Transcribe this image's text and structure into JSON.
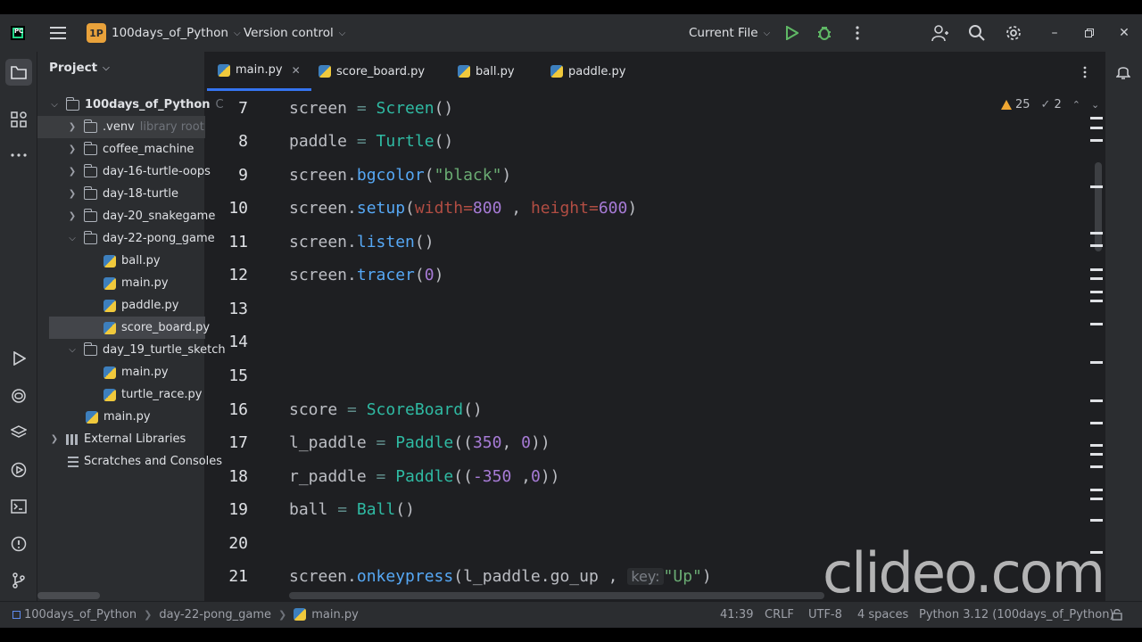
{
  "titlebar": {
    "project_badge": "1P",
    "project_name": "100days_of_Python",
    "vcs_label": "Version control",
    "run_config": "Current File"
  },
  "tabs": [
    {
      "label": "main.py",
      "active": true
    },
    {
      "label": "score_board.py"
    },
    {
      "label": "ball.py"
    },
    {
      "label": "paddle.py"
    }
  ],
  "project_panel": {
    "title": "Project",
    "tree": [
      {
        "label": "100days_of_Python",
        "type": "folder",
        "expanded": true,
        "suffix": "C"
      },
      {
        "label": ".venv",
        "type": "folder",
        "suffix": "library root"
      },
      {
        "label": "coffee_machine",
        "type": "folder"
      },
      {
        "label": "day-16-turtle-oops",
        "type": "folder"
      },
      {
        "label": "day-18-turtle",
        "type": "folder"
      },
      {
        "label": "day-20_snakegame",
        "type": "folder"
      },
      {
        "label": "day-22-pong_game",
        "type": "folder",
        "expanded": true
      },
      {
        "label": "ball.py",
        "type": "py"
      },
      {
        "label": "main.py",
        "type": "py"
      },
      {
        "label": "paddle.py",
        "type": "py"
      },
      {
        "label": "score_board.py",
        "type": "py",
        "selected": true
      },
      {
        "label": "day_19_turtle_sketch",
        "type": "folder",
        "expanded": true
      },
      {
        "label": "main.py",
        "type": "py"
      },
      {
        "label": "turtle_race.py",
        "type": "py"
      },
      {
        "label": "main.py",
        "type": "py"
      },
      {
        "label": "External Libraries",
        "type": "lib"
      },
      {
        "label": "Scratches and Consoles",
        "type": "scratch"
      }
    ]
  },
  "editor": {
    "line_numbers": [
      "7",
      "8",
      "9",
      "10",
      "11",
      "12",
      "13",
      "14",
      "15",
      "16",
      "17",
      "18",
      "19",
      "20",
      "21"
    ],
    "inspections": {
      "warnings": "25",
      "weak_warnings": "2"
    },
    "code": {
      "l7_var": "screen",
      "l7_op": " = ",
      "l7_cls": "Screen",
      "l7_rest": "()",
      "l8_var": "paddle",
      "l8_op": " = ",
      "l8_cls": "Turtle",
      "l8_rest": "()",
      "l9_var": "screen.",
      "l9_call": "bgcolor",
      "l9_p1": "(",
      "l9_str": "\"black\"",
      "l9_p2": ")",
      "l10_var": "screen.",
      "l10_call": "setup",
      "l10_p1": "(",
      "l10_param1": "width=",
      "l10_num1": "800",
      "l10_sep": " , ",
      "l10_param2": "height=",
      "l10_num2": "600",
      "l10_p2": ")",
      "l11_var": "screen.",
      "l11_call": "listen",
      "l11_rest": "()",
      "l12_var": "screen.",
      "l12_call": "tracer",
      "l12_p1": "(",
      "l12_num": "0",
      "l12_p2": ")",
      "l16_var": "score",
      "l16_op": " = ",
      "l16_cls": "ScoreBoard",
      "l16_rest": "()",
      "l17_var": "l_paddle",
      "l17_op": " = ",
      "l17_cls": "Paddle",
      "l17_p1": "((",
      "l17_num1": "350",
      "l17_sep": ", ",
      "l17_num2": "0",
      "l17_p2": "))",
      "l18_var": "r_paddle",
      "l18_op": " = ",
      "l18_cls": "Paddle",
      "l18_p1": "((",
      "l18_num1": "-350",
      "l18_sep": " ,",
      "l18_num2": "0",
      "l18_p2": "))",
      "l19_var": "ball",
      "l19_op": " = ",
      "l19_cls": "Ball",
      "l19_rest": "()",
      "l21_var": "screen.",
      "l21_call": "onkeypress",
      "l21_p1": "(l_paddle.go_up , ",
      "l21_hint": "key:",
      "l21_str": "\"Up\"",
      "l21_p2": ")"
    }
  },
  "statusbar": {
    "breadcrumb": [
      "100days_of_Python",
      "day-22-pong_game",
      "main.py"
    ],
    "position": "41:39",
    "line_sep": "CRLF",
    "encoding": "UTF-8",
    "indent": "4 spaces",
    "interpreter": "Python 3.12 (100days_of_Python)"
  },
  "watermark": "clideo.com",
  "colors": {
    "accent": "#3574f0",
    "keyword_call": "#56a8f5",
    "class_name": "#2fbaa3",
    "string": "#6aab73",
    "number": "#a77bd6",
    "warning": "#f0a732"
  }
}
